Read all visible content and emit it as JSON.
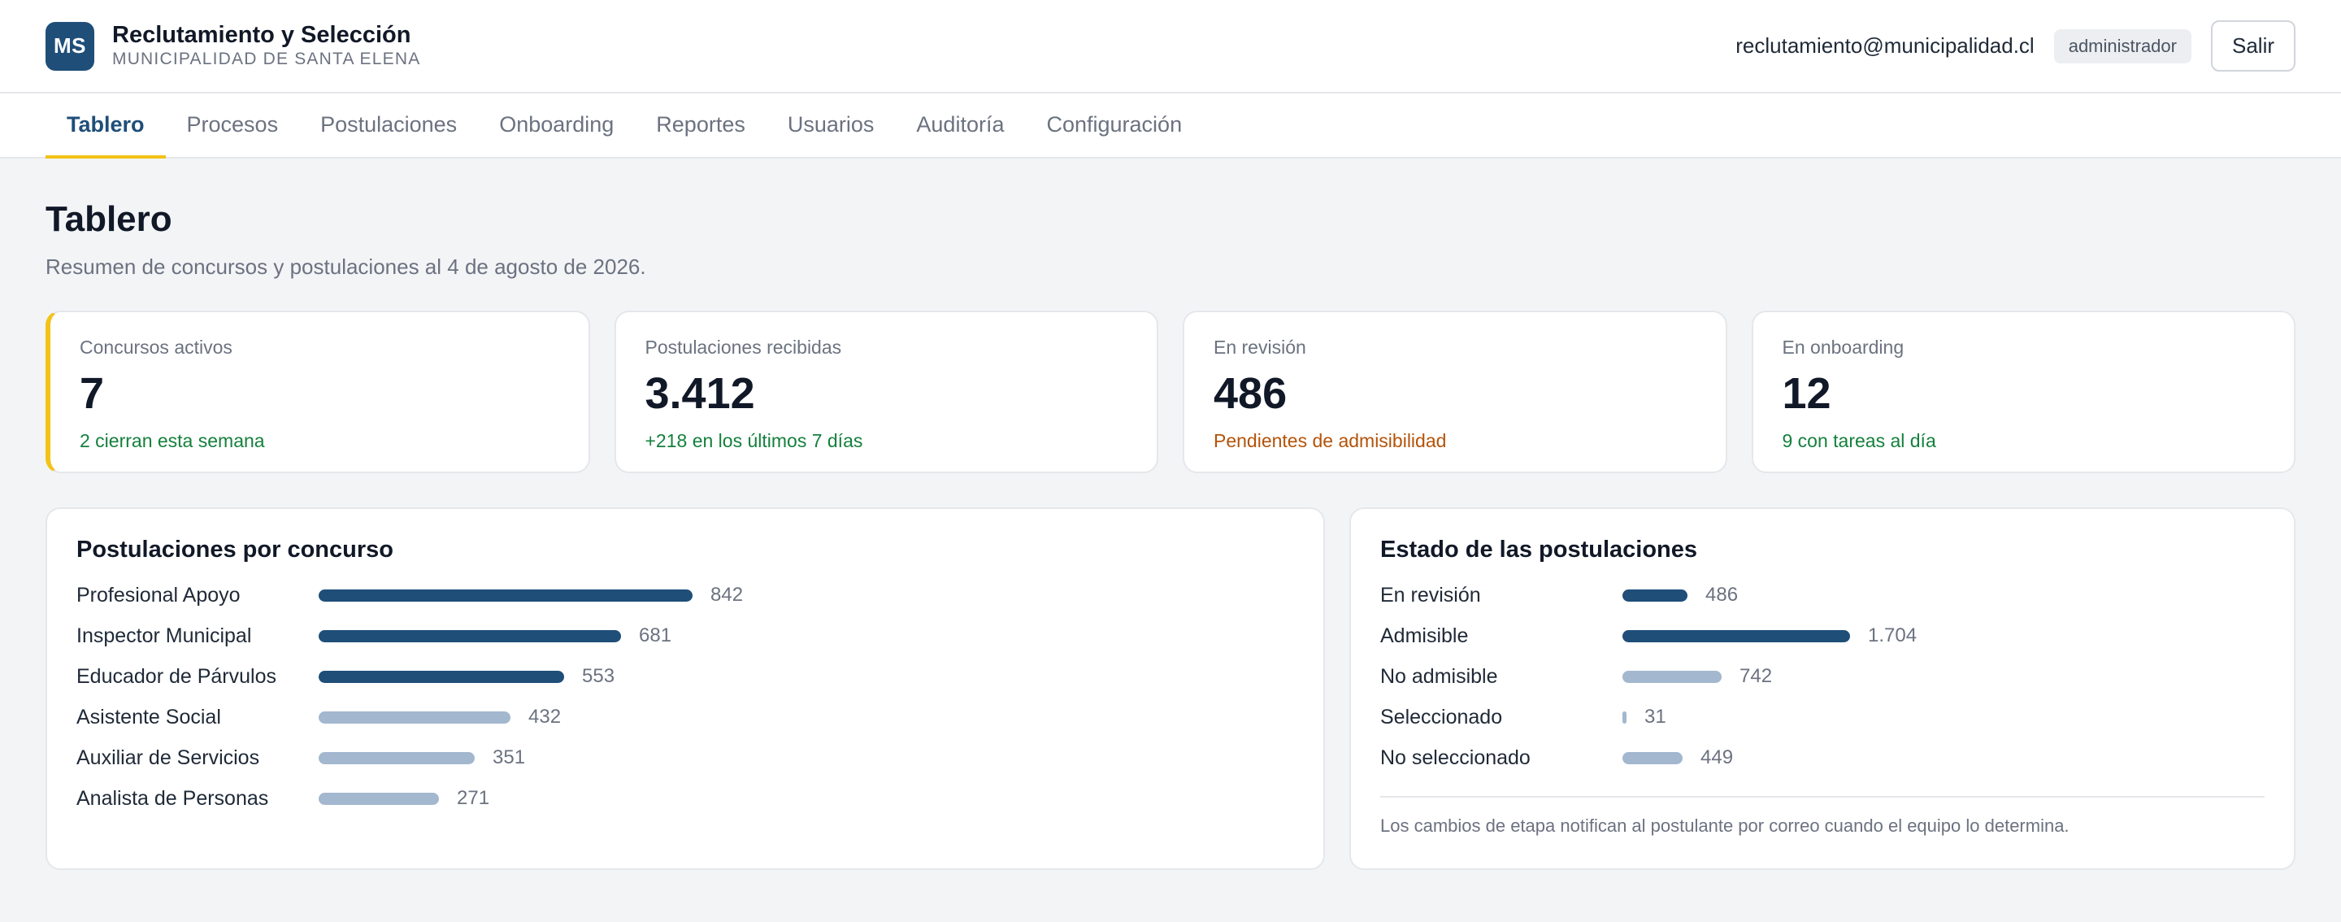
{
  "header": {
    "logo_text": "MS",
    "title": "Reclutamiento y Selección",
    "subtitle": "MUNICIPALIDAD DE SANTA ELENA",
    "user_email": "reclutamiento@municipalidad.cl",
    "role": "administrador",
    "logout_label": "Salir"
  },
  "nav": {
    "tabs": [
      {
        "label": "Tablero",
        "active": true
      },
      {
        "label": "Procesos"
      },
      {
        "label": "Postulaciones"
      },
      {
        "label": "Onboarding"
      },
      {
        "label": "Reportes"
      },
      {
        "label": "Usuarios"
      },
      {
        "label": "Auditoría"
      },
      {
        "label": "Configuración"
      }
    ]
  },
  "page": {
    "title": "Tablero",
    "subtitle": "Resumen de concursos y postulaciones al 4 de agosto de 2026."
  },
  "stats": [
    {
      "label": "Concursos activos",
      "value": "7",
      "note": "2 cierran esta semana",
      "note_tone": "green"
    },
    {
      "label": "Postulaciones recibidas",
      "value": "3.412",
      "note": "+218 en los últimos 7 días",
      "note_tone": "green"
    },
    {
      "label": "En revisión",
      "value": "486",
      "note": "Pendientes de admisibilidad",
      "note_tone": "amber"
    },
    {
      "label": "En onboarding",
      "value": "12",
      "note": "9 con tareas al día",
      "note_tone": "green"
    }
  ],
  "colors": {
    "brand": "#1f4e79",
    "accent": "#f2c318",
    "bar_dark": "#1f4e79",
    "bar_light": "#a3b7cf",
    "positive": "#15803d",
    "warning": "#b45309"
  },
  "by_contest": {
    "title": "Postulaciones por concurso",
    "rows": [
      {
        "label": "Profesional Apoyo",
        "value": 842,
        "value_text": "842",
        "tone": "dark"
      },
      {
        "label": "Inspector Municipal",
        "value": 681,
        "value_text": "681",
        "tone": "dark"
      },
      {
        "label": "Educador de Párvulos",
        "value": 553,
        "value_text": "553",
        "tone": "dark"
      },
      {
        "label": "Asistente Social",
        "value": 432,
        "value_text": "432",
        "tone": "light"
      },
      {
        "label": "Auxiliar de Servicios",
        "value": 351,
        "value_text": "351",
        "tone": "light"
      },
      {
        "label": "Analista de Personas",
        "value": 271,
        "value_text": "271",
        "tone": "light"
      }
    ]
  },
  "by_status": {
    "title": "Estado de las postulaciones",
    "rows": [
      {
        "label": "En revisión",
        "value": 486,
        "value_text": "486",
        "tone": "dark"
      },
      {
        "label": "Admisible",
        "value": 1704,
        "value_text": "1.704",
        "tone": "dark"
      },
      {
        "label": "No admisible",
        "value": 742,
        "value_text": "742",
        "tone": "light"
      },
      {
        "label": "Seleccionado",
        "value": 31,
        "value_text": "31",
        "tone": "light"
      },
      {
        "label": "No seleccionado",
        "value": 449,
        "value_text": "449",
        "tone": "light"
      }
    ],
    "footnote": "Los cambios de etapa notifican al postulante por correo cuando el equipo lo determina."
  }
}
